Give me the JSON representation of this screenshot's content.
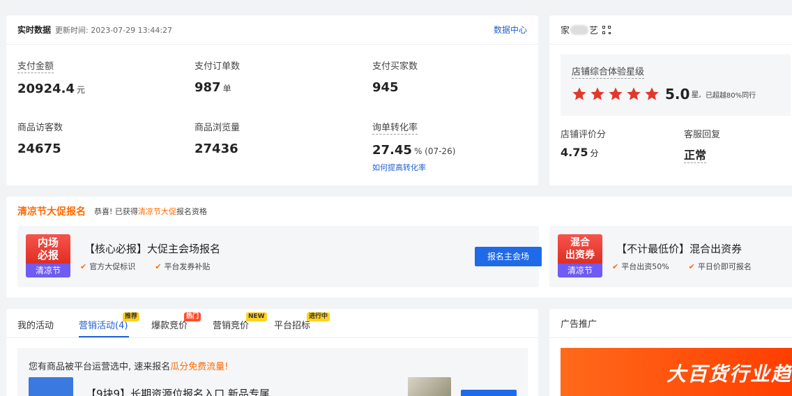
{
  "realtime": {
    "title": "实时数据",
    "updated": "更新时间: 2023-07-29 13:44:27",
    "data_center": "数据中心",
    "metrics": [
      {
        "label": "支付金额",
        "value": "20924.4",
        "unit": "元"
      },
      {
        "label": "支付订单数",
        "value": "987",
        "unit": "单"
      },
      {
        "label": "支付买家数",
        "value": "945",
        "unit": ""
      },
      {
        "label": "商品访客数",
        "value": "24675",
        "unit": ""
      },
      {
        "label": "商品浏览量",
        "value": "27436",
        "unit": ""
      },
      {
        "label": "询单转化率",
        "value": "27.45",
        "unit": "% (07-26)",
        "sub": "如何提高转化率"
      }
    ]
  },
  "shop": {
    "name_left": "家",
    "name_right": "艺",
    "rating_label": "店铺综合体验星级",
    "stars": 5,
    "score": "5.0",
    "score_unit": "星,",
    "score_note": "已超越80%同行",
    "review_label": "店铺评价分",
    "review_value": "4.75",
    "review_unit": "分",
    "service_label": "客服回复",
    "service_value": "正常",
    "star_color": "#e0392b"
  },
  "promo": {
    "title": "清凉节大促报名",
    "msg_prefix": "恭喜! 已获得",
    "msg_highlight": "清凉节大促",
    "msg_suffix": "报名资格",
    "items": [
      {
        "badge_l1": "内场",
        "badge_l2": "必报",
        "badge_sub": "清凉节",
        "title": "【核心必报】大促主会场报名",
        "feat1": "官方大促标识",
        "feat2": "平台发券补贴",
        "button": "报名主会场"
      },
      {
        "badge_l1": "混合",
        "badge_l2": "出资券",
        "badge_sub": "清凉节",
        "title": "【不计最低价】混合出资券",
        "feat1": "平台出资50%",
        "feat2": "平日价即可报名"
      }
    ]
  },
  "activities": {
    "tabs": [
      "我的活动",
      "营销活动(4)",
      "爆款竞价",
      "营销竞价",
      "平台招标"
    ],
    "tags": [
      "推荐",
      "热门",
      "NEW",
      "进行中"
    ],
    "note_prefix": "您有商品被平台运营选中, 速来报名",
    "note_highlight": "瓜分免费流量!",
    "item_title": "【9块9】长期资源位报名入口 新品专属"
  },
  "ads": {
    "title": "广告推广",
    "banner_text": "大百货行业趋"
  },
  "colors": {
    "accent": "#1f5ed3",
    "orange": "#ff6a00",
    "button": "#1f6ae8"
  }
}
